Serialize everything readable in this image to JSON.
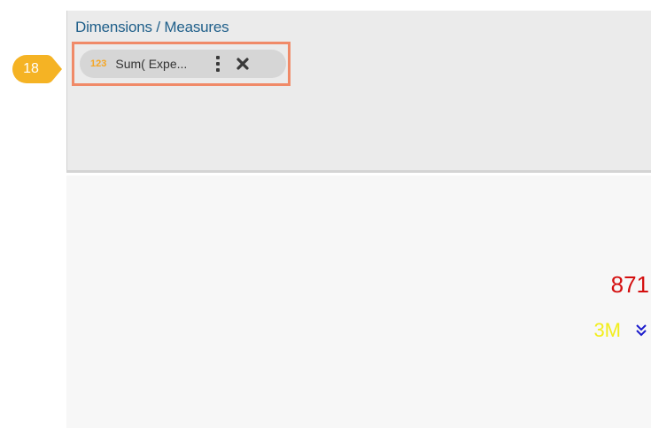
{
  "panel": {
    "title": "Dimensions / Measures"
  },
  "chip": {
    "type_label": "123",
    "label": "Sum( Expe...",
    "menu_icon": "vertical-ellipsis-icon",
    "close_icon": "close-icon"
  },
  "step_marker": {
    "number": "18",
    "color": "#f5b324"
  },
  "kpi": {
    "value": "871",
    "value_color": "#d40f0f",
    "compare_value": "3M",
    "compare_color": "#f2ee1b",
    "trend_icon": "double-chevron-down-icon",
    "trend_color": "#1b1bcc"
  },
  "colors": {
    "highlight_border": "#f08a68",
    "title": "#1f5f8a"
  }
}
